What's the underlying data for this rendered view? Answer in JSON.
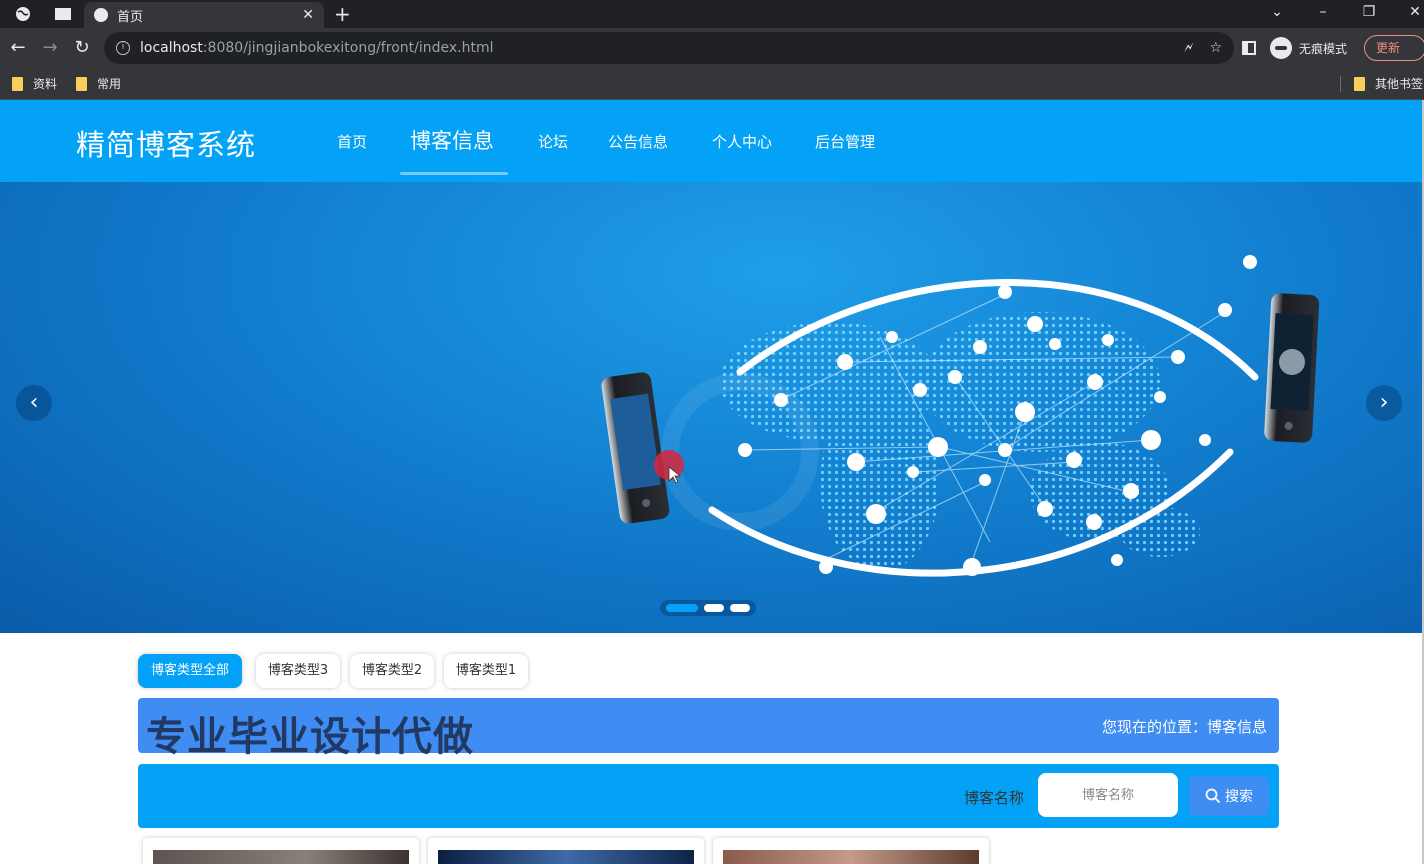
{
  "browser": {
    "tab_title": "首页",
    "url_host": "localhost",
    "url_rest": ":8080/jingjianbokexitong/front/index.html",
    "incognito_label": "无痕模式",
    "update_label": "更新",
    "bookmarks": [
      {
        "label": "资料"
      },
      {
        "label": "常用"
      }
    ],
    "other_bookmarks": "其他书签"
  },
  "site": {
    "title": "精简博客系统",
    "nav": [
      {
        "label": "首页",
        "active": false
      },
      {
        "label": "博客信息",
        "active": true
      },
      {
        "label": "论坛",
        "active": false
      },
      {
        "label": "公告信息",
        "active": false
      },
      {
        "label": "个人中心",
        "active": false
      },
      {
        "label": "后台管理",
        "active": false
      }
    ]
  },
  "carousel": {
    "prev_icon": "chevron-left-icon",
    "next_icon": "chevron-right-icon",
    "slides": 3,
    "active_slide": 1
  },
  "blog_types": [
    {
      "label": "博客类型全部",
      "active": true
    },
    {
      "label": "博客类型3",
      "active": false
    },
    {
      "label": "博客类型2",
      "active": false
    },
    {
      "label": "博客类型1",
      "active": false
    }
  ],
  "position_bar": {
    "watermark": "专业毕业设计代做",
    "location": "您现在的位置：博客信息"
  },
  "search": {
    "label": "博客名称",
    "placeholder": "博客名称",
    "button_label": "搜索"
  },
  "colors": {
    "brand": "#03a2f6",
    "accent": "#3f8cf3",
    "chrome_dark": "#202124",
    "chrome_mid": "#35363a"
  }
}
